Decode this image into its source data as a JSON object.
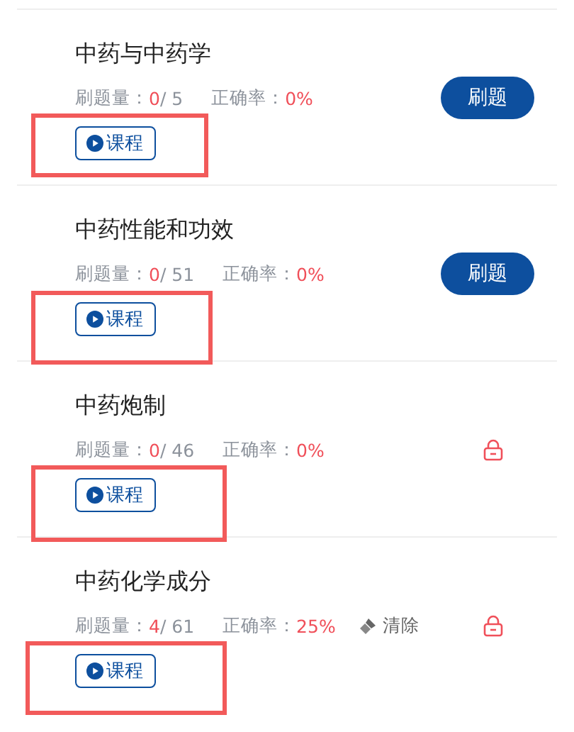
{
  "chapters": [
    {
      "title": "中药与中药学",
      "count_label": "刷题量：",
      "done": "0",
      "total": "/ 5",
      "accuracy_label": "正确率：",
      "accuracy": "0%",
      "action": {
        "kind": "practice",
        "label": "刷题"
      },
      "course": {
        "label": "课程",
        "highlighted": true
      }
    },
    {
      "title": "中药性能和功效",
      "count_label": "刷题量：",
      "done": "0",
      "total": "/ 51",
      "accuracy_label": "正确率：",
      "accuracy": "0%",
      "action": {
        "kind": "practice",
        "label": "刷题"
      },
      "course": {
        "label": "课程",
        "highlighted": true
      }
    },
    {
      "title": "中药炮制",
      "count_label": "刷题量：",
      "done": "0",
      "total": "/ 46",
      "accuracy_label": "正确率：",
      "accuracy": "0%",
      "action": {
        "kind": "locked"
      },
      "course": {
        "label": "课程",
        "highlighted": true
      }
    },
    {
      "title": "中药化学成分",
      "count_label": "刷题量：",
      "done": "4",
      "total": "/ 61",
      "accuracy_label": "正确率：",
      "accuracy": "25%",
      "clear_label": "清除",
      "action": {
        "kind": "locked"
      },
      "course": {
        "label": "课程",
        "highlighted": true
      }
    }
  ]
}
